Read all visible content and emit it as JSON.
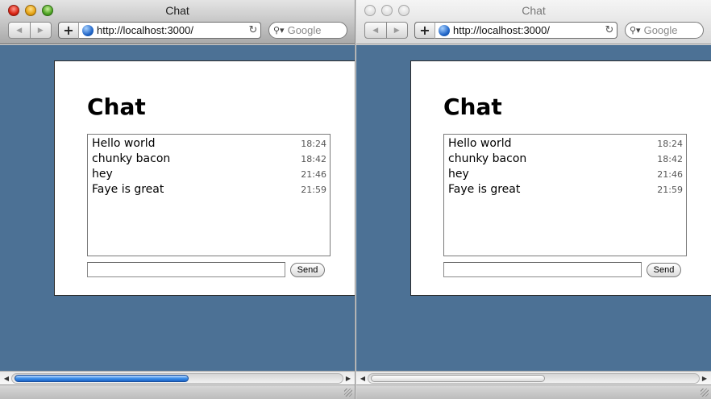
{
  "windows": [
    {
      "title": "Chat",
      "url": "http://localhost:3000/",
      "search_placeholder": "Google",
      "page": {
        "heading": "Chat",
        "messages": [
          {
            "text": "Hello world",
            "time": "18:24"
          },
          {
            "text": "chunky bacon",
            "time": "18:42"
          },
          {
            "text": "hey",
            "time": "21:46"
          },
          {
            "text": "Faye is great",
            "time": "21:59"
          }
        ],
        "input_value": "",
        "send_label": "Send"
      }
    },
    {
      "title": "Chat",
      "url": "http://localhost:3000/",
      "search_placeholder": "Google",
      "page": {
        "heading": "Chat",
        "messages": [
          {
            "text": "Hello world",
            "time": "18:24"
          },
          {
            "text": "chunky bacon",
            "time": "18:42"
          },
          {
            "text": "hey",
            "time": "21:46"
          },
          {
            "text": "Faye is great",
            "time": "21:59"
          }
        ],
        "input_value": "",
        "send_label": "Send"
      }
    }
  ],
  "icons": {
    "back": "back-arrow-icon",
    "forward": "forward-arrow-icon",
    "add": "plus-icon",
    "site": "globe-icon",
    "reload": "reload-icon",
    "search": "search-icon"
  },
  "colors": {
    "page_background": "#4c7195",
    "panel_background": "#ffffff"
  }
}
